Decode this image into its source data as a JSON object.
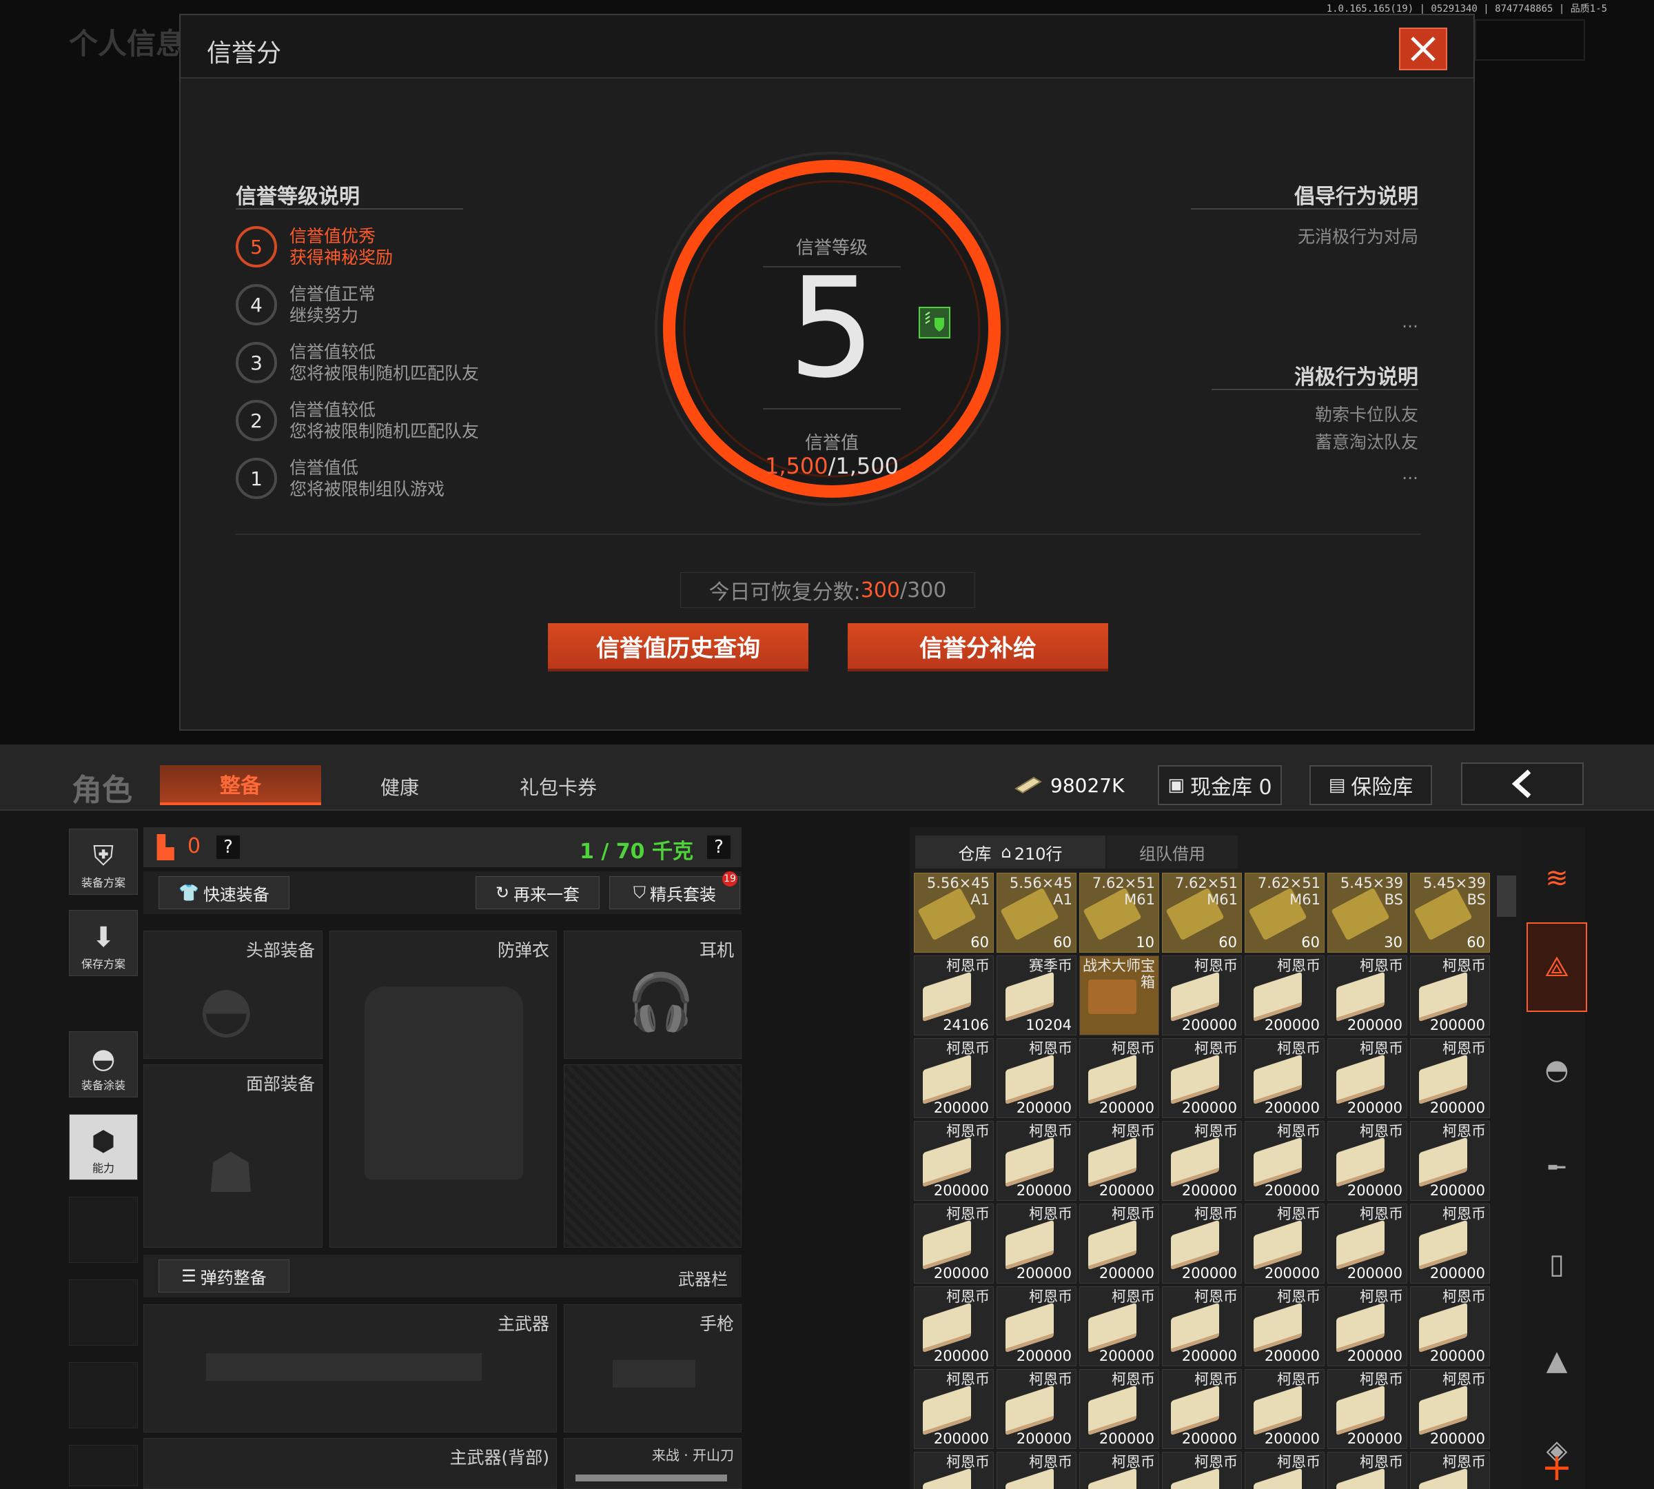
{
  "version_text": "1.0.165.165(19) | 05291340 | 8747748865 | 品质1-5",
  "top": {
    "bg_title": "个人信息",
    "modal": {
      "title": "信誉分",
      "level_section_title": "信誉等级说明",
      "levels": [
        {
          "num": "5",
          "line1": "信誉值优秀",
          "line2": "获得神秘奖励"
        },
        {
          "num": "4",
          "line1": "信誉值正常",
          "line2": "继续努力"
        },
        {
          "num": "3",
          "line1": "信誉值较低",
          "line2": "您将被限制随机匹配队友"
        },
        {
          "num": "2",
          "line1": "信誉值较低",
          "line2": "您将被限制随机匹配队友"
        },
        {
          "num": "1",
          "line1": "信誉值低",
          "line2": "您将被限制组队游戏"
        }
      ],
      "ring": {
        "level_label": "信誉等级",
        "level_value": "5",
        "score_label": "信誉值",
        "score_current": "1,500",
        "score_max": "/1,500"
      },
      "advocate_title": "倡导行为说明",
      "advocate_items": [
        "无消极行为对局"
      ],
      "negative_title": "消极行为说明",
      "negative_items": [
        "勒索卡位队友",
        "蓄意淘汰队友"
      ],
      "ellipsis": "...",
      "recover_label": "今日可恢复分数:",
      "recover_current": "300",
      "recover_max": "/300",
      "history_button": "信誉值历史查询",
      "supplement_button": "信誉分补给"
    }
  },
  "bottom": {
    "title": "角色",
    "tabs": [
      "整备",
      "健康",
      "礼包卡券"
    ],
    "money": "98027K",
    "cash_vault": "现金库 0",
    "safe": "保险库",
    "left_icons": [
      "装备方案",
      "保存方案",
      "装备涂装",
      "能力"
    ],
    "armor_count": "0",
    "weight": "1 / 70 千克",
    "question": "?",
    "quick_equip": "快速装备",
    "again": "再来一套",
    "elite": "精兵套装",
    "elite_badge": "19",
    "slots": {
      "head": "头部装备",
      "vest": "防弹衣",
      "ear": "耳机",
      "face": "面部装备",
      "ammo_equip": "弹药整备",
      "weapon_bar": "武器栏",
      "main_weapon": "主武器",
      "pistol": "手枪",
      "main_back": "主武器(背部)",
      "melee": "来战 · 开山刀"
    },
    "warehouse_tab": "仓库",
    "warehouse_rows": "210行",
    "team_borrow": "组队借用",
    "grid_row1": [
      {
        "t1": "5.56×45",
        "t2": "A1",
        "q": "60"
      },
      {
        "t1": "5.56×45",
        "t2": "A1",
        "q": "60"
      },
      {
        "t1": "7.62×51",
        "t2": "M61",
        "q": "10"
      },
      {
        "t1": "7.62×51",
        "t2": "M61",
        "q": "60"
      },
      {
        "t1": "7.62×51",
        "t2": "M61",
        "q": "60"
      },
      {
        "t1": "5.45×39",
        "t2": "BS",
        "q": "30"
      },
      {
        "t1": "5.45×39",
        "t2": "BS",
        "q": "60"
      }
    ],
    "grid_row2": [
      {
        "t1": "柯恩币",
        "t2": "",
        "q": "24106"
      },
      {
        "t1": "赛季币",
        "t2": "",
        "q": "10204"
      },
      {
        "t1": "战术大师宝",
        "t2": "箱",
        "q": ""
      },
      {
        "t1": "柯恩币",
        "t2": "",
        "q": "200000"
      },
      {
        "t1": "柯恩币",
        "t2": "",
        "q": "200000"
      },
      {
        "t1": "柯恩币",
        "t2": "",
        "q": "200000"
      },
      {
        "t1": "柯恩币",
        "t2": "",
        "q": "200000"
      }
    ],
    "coin_label": "柯恩币",
    "coin_qty": "200000"
  },
  "colors": {
    "accent": "#e0471b",
    "ring": "#ff4a10",
    "green": "#4fd33a"
  },
  "icons": [
    "close-icon",
    "back-arrow-icon",
    "home-icon",
    "vest-icon",
    "download-icon",
    "helmet-paint-icon",
    "ability-icon",
    "stack-icon",
    "helmet-icon",
    "rifle-icon",
    "magazine-icon",
    "bullet-icon",
    "scope-icon",
    "plus-icon"
  ]
}
